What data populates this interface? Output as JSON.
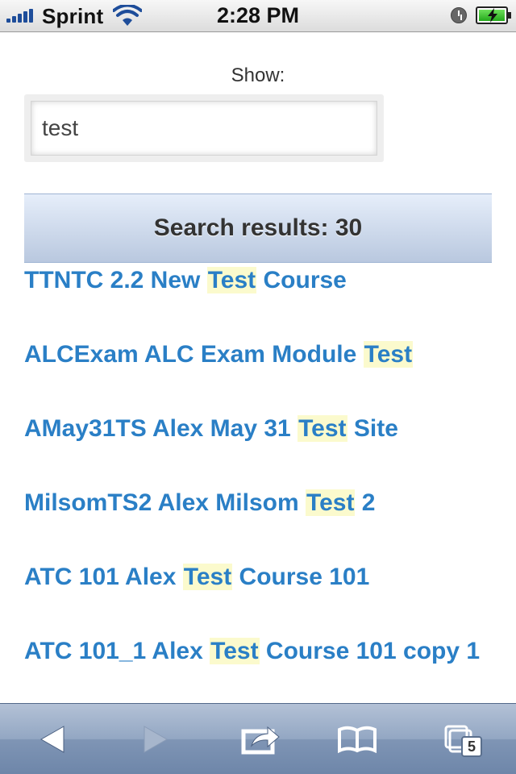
{
  "status_bar": {
    "carrier": "Sprint",
    "time": "2:28 PM"
  },
  "filter": {
    "label": "Show:",
    "value": "test"
  },
  "results": {
    "header": "Search results: 30",
    "items": [
      {
        "before": "TTNTC 2.2 New ",
        "match": "Test",
        "after": " Course"
      },
      {
        "before": "ALCExam ALC Exam Module ",
        "match": "Test",
        "after": ""
      },
      {
        "before": "AMay31TS Alex May 31 ",
        "match": "Test",
        "after": " Site"
      },
      {
        "before": "MilsomTS2 Alex Milsom ",
        "match": "Test",
        "after": " 2"
      },
      {
        "before": "ATC 101 Alex ",
        "match": "Test",
        "after": " Course 101"
      },
      {
        "before": "ATC 101_1 Alex ",
        "match": "Test",
        "after": " Course 101 copy 1"
      }
    ]
  },
  "toolbar": {
    "icons": [
      "back-icon",
      "forward-icon",
      "share-icon",
      "bookmarks-icon",
      "pages-icon"
    ],
    "pages_count": "5"
  },
  "colors": {
    "link": "#2a7fc6",
    "highlight": "#fbfacd",
    "toolbar": "#8ba0bf"
  }
}
